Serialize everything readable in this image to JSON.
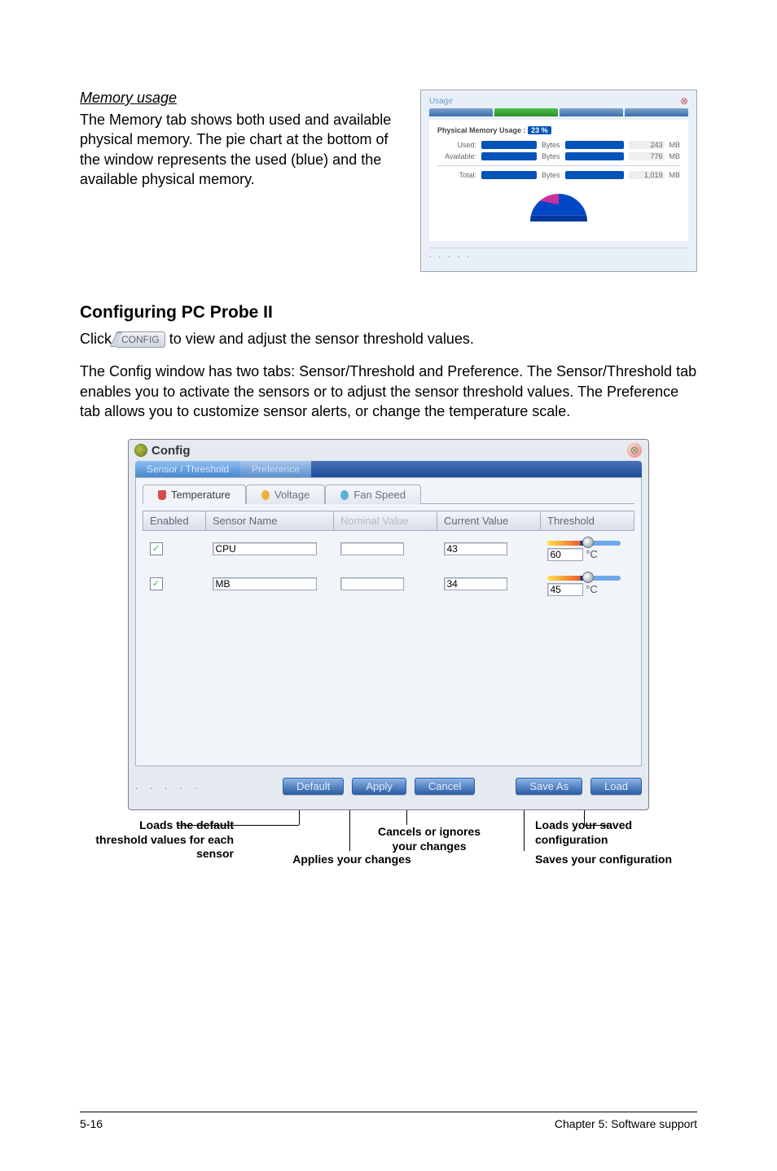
{
  "memory_section": {
    "title": "Memory usage",
    "paragraph": "The Memory tab shows both used and available physical memory. The pie chart at the bottom of the window represents the used (blue) and the available physical memory."
  },
  "mem_thumb": {
    "app_title": "Usage",
    "heading": "Physical Memory Usage :",
    "heading_pct": "23 %",
    "rows": [
      {
        "label": "Used:",
        "val1": "",
        "unit1": "Bytes",
        "mb": "243",
        "mbunit": "MB"
      },
      {
        "label": "Available:",
        "val1": "",
        "unit1": "Bytes",
        "mb": "776",
        "mbunit": "MB"
      },
      {
        "label": "Total:",
        "val1": "",
        "unit1": "Bytes",
        "mb": "1,019",
        "mbunit": "MB"
      }
    ]
  },
  "h2": "Configuring PC Probe II",
  "click_line_pre": "Click ",
  "config_btn_label": "CONFIG",
  "click_line_post": " to view and adjust the sensor threshold values.",
  "config_para": "The Config window has two tabs: Sensor/Threshold and Preference. The Sensor/Threshold tab enables you to activate the sensors or to adjust the sensor threshold values. The Preference tab allows you to customize sensor alerts, or change the temperature scale.",
  "config_win": {
    "title": "Config",
    "close": "⊗",
    "top_tabs": {
      "active": "Sensor / Threshold",
      "other": "Preference"
    },
    "sub_tabs": {
      "temperature": "Temperature",
      "voltage": "Voltage",
      "fan": "Fan Speed"
    },
    "columns": {
      "enabled": "Enabled",
      "sensor_name": "Sensor Name",
      "nominal": "Nominal Value",
      "current": "Current Value",
      "threshold": "Threshold"
    },
    "rows": [
      {
        "enabled": true,
        "name": "CPU",
        "nominal": "",
        "current": "43",
        "threshold": "60",
        "unit": "°C"
      },
      {
        "enabled": true,
        "name": "MB",
        "nominal": "",
        "current": "34",
        "threshold": "45",
        "unit": "°C"
      }
    ],
    "buttons": {
      "default": "Default",
      "apply": "Apply",
      "cancel": "Cancel",
      "saveas": "Save As",
      "load": "Load"
    }
  },
  "callouts": {
    "default": "Loads the default threshold values for each sensor",
    "apply": "Applies your changes",
    "cancel": "Cancels or ignores your changes",
    "load": "Loads your saved configuration",
    "saveas": "Saves your configuration"
  },
  "footer": {
    "left": "5-16",
    "right": "Chapter 5: Software support"
  }
}
